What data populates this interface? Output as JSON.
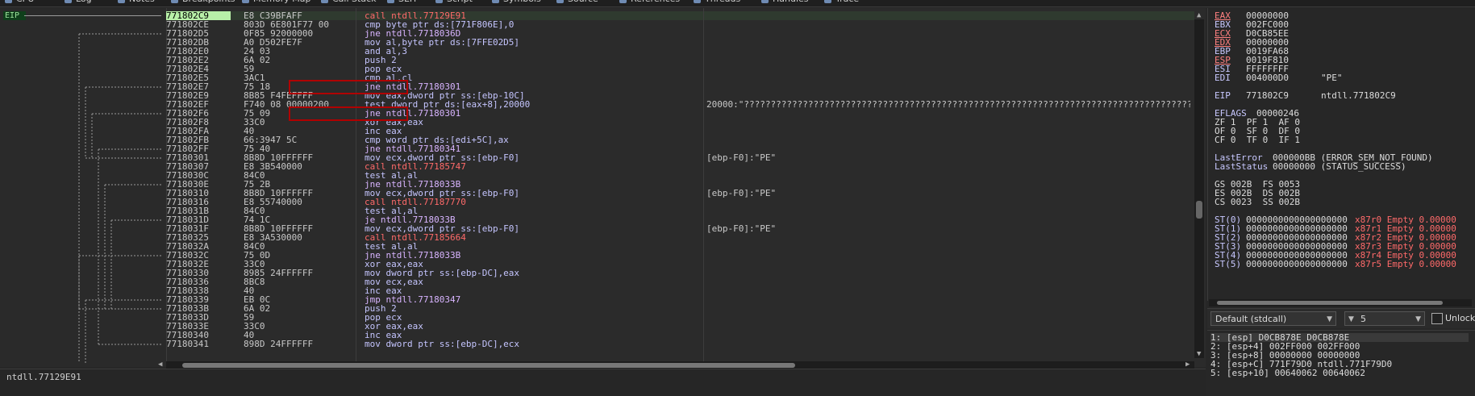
{
  "tabs": [
    {
      "label": "CPU",
      "icon": "cpu-icon"
    },
    {
      "label": "Log",
      "icon": "log-icon"
    },
    {
      "label": "Notes",
      "icon": "notes-icon"
    },
    {
      "label": "Breakpoints",
      "icon": "breakpoint-icon"
    },
    {
      "label": "Memory Map",
      "icon": "memory-map-icon"
    },
    {
      "label": "Call Stack",
      "icon": "call-stack-icon"
    },
    {
      "label": "SEH",
      "icon": "seh-icon"
    },
    {
      "label": "Script",
      "icon": "script-icon"
    },
    {
      "label": "Symbols",
      "icon": "symbols-icon"
    },
    {
      "label": "Source",
      "icon": "source-icon"
    },
    {
      "label": "References",
      "icon": "references-icon"
    },
    {
      "label": "Threads",
      "icon": "threads-icon"
    },
    {
      "label": "Handles",
      "icon": "handles-icon"
    },
    {
      "label": "Trace",
      "icon": "trace-icon"
    }
  ],
  "eip_label": "EIP",
  "disasm": [
    {
      "addr": "771802C9",
      "bytes": "E8 C39BFAFF",
      "instr": "call ntdll.77129E91",
      "kind": "call",
      "comment": "",
      "current": true
    },
    {
      "addr": "771802CE",
      "bytes": "803D 6E801F77 00",
      "instr": "cmp byte ptr ds:[771F806E],0",
      "kind": "other",
      "comment": ""
    },
    {
      "addr": "771802D5",
      "bytes": "0F85 92000000",
      "instr": "jne ntdll.7718036D",
      "kind": "jmp",
      "comment": ""
    },
    {
      "addr": "771802DB",
      "bytes": "A0 D502FE7F",
      "instr": "mov al,byte ptr ds:[7FFE02D5]",
      "kind": "other",
      "comment": ""
    },
    {
      "addr": "771802E0",
      "bytes": "24 03",
      "instr": "and al,3",
      "kind": "other",
      "comment": ""
    },
    {
      "addr": "771802E2",
      "bytes": "6A 02",
      "instr": "push 2",
      "kind": "other",
      "comment": ""
    },
    {
      "addr": "771802E4",
      "bytes": "59",
      "instr": "pop ecx",
      "kind": "other",
      "comment": ""
    },
    {
      "addr": "771802E5",
      "bytes": "3AC1",
      "instr": "cmp al,cl",
      "kind": "other",
      "comment": ""
    },
    {
      "addr": "771802E7",
      "bytes": "75 18",
      "instr": "jne ntdll.77180301",
      "kind": "jmp",
      "comment": ""
    },
    {
      "addr": "771802E9",
      "bytes": "8B85 F4FEFFFF",
      "instr": "mov eax,dword ptr ss:[ebp-10C]",
      "kind": "other",
      "comment": ""
    },
    {
      "addr": "771802EF",
      "bytes": "F740 08 00000200",
      "instr": "test dword ptr ds:[eax+8],20000",
      "kind": "other",
      "comment": "20000:\"????????????????????????????????????????????????????????????????????????????????????\""
    },
    {
      "addr": "771802F6",
      "bytes": "75 09",
      "instr": "jne ntdll.77180301",
      "kind": "jmp",
      "comment": ""
    },
    {
      "addr": "771802F8",
      "bytes": "33C0",
      "instr": "xor eax,eax",
      "kind": "other",
      "comment": ""
    },
    {
      "addr": "771802FA",
      "bytes": "40",
      "instr": "inc eax",
      "kind": "other",
      "comment": ""
    },
    {
      "addr": "771802FB",
      "bytes": "66:3947 5C",
      "instr": "cmp word ptr ds:[edi+5C],ax",
      "kind": "other",
      "comment": ""
    },
    {
      "addr": "771802FF",
      "bytes": "75 40",
      "instr": "jne ntdll.77180341",
      "kind": "jmp",
      "comment": ""
    },
    {
      "addr": "77180301",
      "bytes": "8B8D 10FFFFFF",
      "instr": "mov ecx,dword ptr ss:[ebp-F0]",
      "kind": "other",
      "comment": "[ebp-F0]:\"PE\""
    },
    {
      "addr": "77180307",
      "bytes": "E8 3B540000",
      "instr": "call ntdll.77185747",
      "kind": "call",
      "comment": ""
    },
    {
      "addr": "7718030C",
      "bytes": "84C0",
      "instr": "test al,al",
      "kind": "other",
      "comment": ""
    },
    {
      "addr": "7718030E",
      "bytes": "75 2B",
      "instr": "jne ntdll.7718033B",
      "kind": "jmp",
      "comment": ""
    },
    {
      "addr": "77180310",
      "bytes": "8B8D 10FFFFFF",
      "instr": "mov ecx,dword ptr ss:[ebp-F0]",
      "kind": "other",
      "comment": "[ebp-F0]:\"PE\""
    },
    {
      "addr": "77180316",
      "bytes": "E8 55740000",
      "instr": "call ntdll.77187770",
      "kind": "call",
      "comment": ""
    },
    {
      "addr": "7718031B",
      "bytes": "84C0",
      "instr": "test al,al",
      "kind": "other",
      "comment": ""
    },
    {
      "addr": "7718031D",
      "bytes": "74 1C",
      "instr": "je ntdll.7718033B",
      "kind": "jmp",
      "comment": ""
    },
    {
      "addr": "7718031F",
      "bytes": "8B8D 10FFFFFF",
      "instr": "mov ecx,dword ptr ss:[ebp-F0]",
      "kind": "other",
      "comment": "[ebp-F0]:\"PE\""
    },
    {
      "addr": "77180325",
      "bytes": "E8 3A530000",
      "instr": "call ntdll.77185664",
      "kind": "call",
      "comment": ""
    },
    {
      "addr": "7718032A",
      "bytes": "84C0",
      "instr": "test al,al",
      "kind": "other",
      "comment": ""
    },
    {
      "addr": "7718032C",
      "bytes": "75 0D",
      "instr": "jne ntdll.7718033B",
      "kind": "jmp",
      "comment": ""
    },
    {
      "addr": "7718032E",
      "bytes": "33C0",
      "instr": "xor eax,eax",
      "kind": "other",
      "comment": ""
    },
    {
      "addr": "77180330",
      "bytes": "8985 24FFFFFF",
      "instr": "mov dword ptr ss:[ebp-DC],eax",
      "kind": "other",
      "comment": ""
    },
    {
      "addr": "77180336",
      "bytes": "8BC8",
      "instr": "mov ecx,eax",
      "kind": "other",
      "comment": ""
    },
    {
      "addr": "77180338",
      "bytes": "40",
      "instr": "inc eax",
      "kind": "other",
      "comment": ""
    },
    {
      "addr": "77180339",
      "bytes": "EB 0C",
      "instr": "jmp ntdll.77180347",
      "kind": "jmp",
      "comment": ""
    },
    {
      "addr": "7718033B",
      "bytes": "6A 02",
      "instr": "push 2",
      "kind": "other",
      "comment": ""
    },
    {
      "addr": "7718033D",
      "bytes": "59",
      "instr": "pop ecx",
      "kind": "other",
      "comment": ""
    },
    {
      "addr": "7718033E",
      "bytes": "33C0",
      "instr": "xor eax,eax",
      "kind": "other",
      "comment": ""
    },
    {
      "addr": "77180340",
      "bytes": "40",
      "instr": "inc eax",
      "kind": "other",
      "comment": ""
    },
    {
      "addr": "77180341",
      "bytes": "898D 24FFFFFF",
      "instr": "mov dword ptr ss:[ebp-DC],ecx",
      "kind": "other",
      "comment": ""
    }
  ],
  "highlight_boxes": [
    8,
    11
  ],
  "status_text": "ntdll.77129E91",
  "registers": [
    {
      "name": "EAX",
      "value": "00000000",
      "comment": "",
      "underline": true
    },
    {
      "name": "EBX",
      "value": "002FC000",
      "comment": ""
    },
    {
      "name": "ECX",
      "value": "D0CB85EE",
      "comment": "",
      "underline": true
    },
    {
      "name": "EDX",
      "value": "00000000",
      "comment": "",
      "underline": true
    },
    {
      "name": "EBP",
      "value": "0019FA68",
      "comment": ""
    },
    {
      "name": "ESP",
      "value": "0019F810",
      "comment": "",
      "underline": true
    },
    {
      "name": "ESI",
      "value": "FFFFFFFF",
      "comment": ""
    },
    {
      "name": "EDI",
      "value": "004000D0",
      "comment": "\"PE\""
    }
  ],
  "eip_reg": {
    "name": "EIP",
    "value": "771802C9",
    "comment": "ntdll.771802C9"
  },
  "eflags": {
    "name": "EFLAGS",
    "value": "00000246"
  },
  "flag_rows": [
    "ZF 1  PF 1  AF 0",
    "OF 0  SF 0  DF 0",
    "CF 0  TF 0  IF 1"
  ],
  "last_error": {
    "name": "LastError",
    "value": "000000BB (ERROR_SEM_NOT_FOUND)"
  },
  "last_status": {
    "name": "LastStatus",
    "value": "00000000 (STATUS_SUCCESS)"
  },
  "seg_rows": [
    "GS 002B  FS 0053",
    "ES 002B  DS 002B",
    "CS 0023  SS 002B"
  ],
  "fpu": [
    {
      "name": "ST(0)",
      "value": "0000000000000000000",
      "tag": "x87r0 Empty 0.00000"
    },
    {
      "name": "ST(1)",
      "value": "0000000000000000000",
      "tag": "x87r1 Empty 0.00000"
    },
    {
      "name": "ST(2)",
      "value": "0000000000000000000",
      "tag": "x87r2 Empty 0.00000"
    },
    {
      "name": "ST(3)",
      "value": "0000000000000000000",
      "tag": "x87r3 Empty 0.00000"
    },
    {
      "name": "ST(4)",
      "value": "0000000000000000000",
      "tag": "x87r4 Empty 0.00000"
    },
    {
      "name": "ST(5)",
      "value": "0000000000000000000",
      "tag": "x87r5 Empty 0.00000"
    }
  ],
  "callconv_select": "Default (stdcall)",
  "argcount_select": "5",
  "unlock_label": "Unlock",
  "stack": [
    "1: [esp] D0CB878E D0CB878E",
    "2: [esp+4] 002FF000 002FF000",
    "3: [esp+8] 00000000 00000000",
    "4: [esp+C] 771F79D0 ntdll.771F79D0",
    "5: [esp+10] 00640062 00640062"
  ],
  "colors": {
    "call": "#ff6a6a",
    "jump": "#d8b4ff",
    "current_addr_bg": "#b8f0a8",
    "highlight_box": "#b00000"
  }
}
